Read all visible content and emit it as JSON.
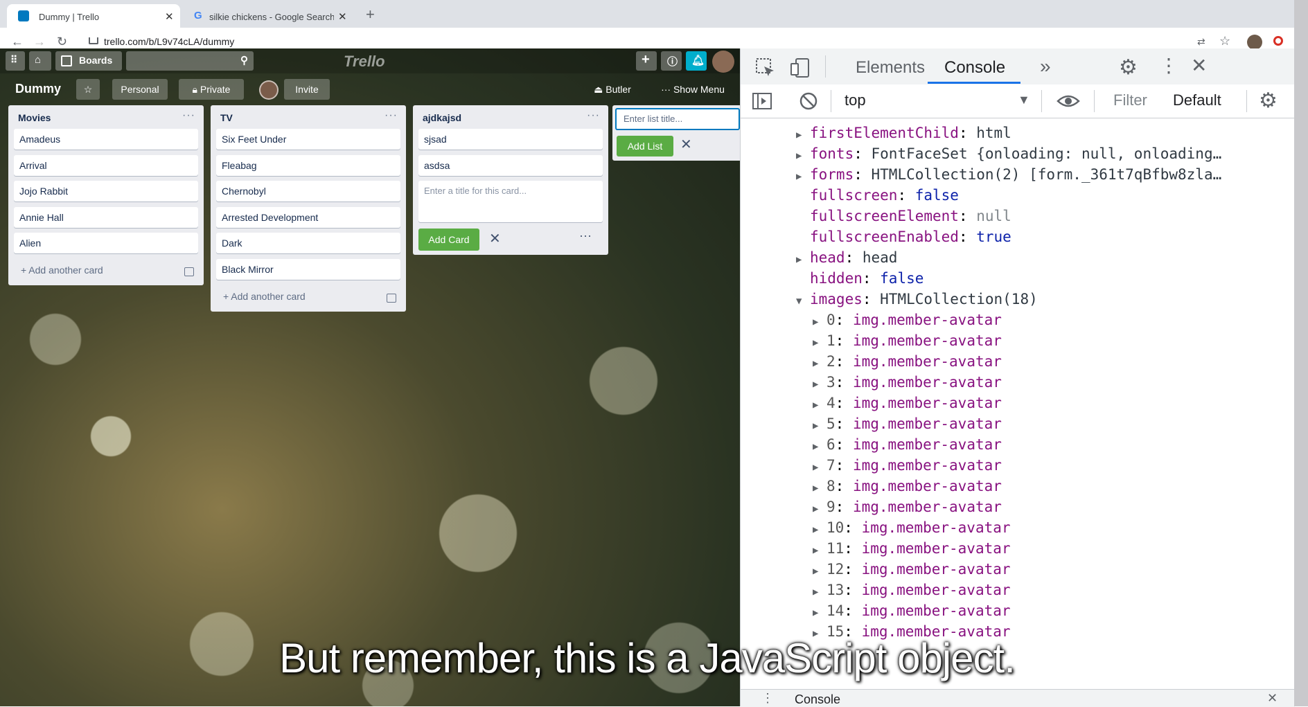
{
  "browser": {
    "tabs": [
      {
        "title": "Dummy | Trello",
        "active": true
      },
      {
        "title": "silkie chickens - Google Search",
        "active": false
      }
    ],
    "url": "trello.com/b/L9v74cLA/dummy"
  },
  "trello": {
    "top": {
      "boards_label": "Boards",
      "logo": "Trello"
    },
    "header": {
      "board_name": "Dummy",
      "personal_label": "Personal",
      "private_label": "Private",
      "invite_label": "Invite",
      "butler_label": "Butler",
      "show_menu_label": "Show Menu"
    },
    "lists": [
      {
        "title": "Movies",
        "cards": [
          "Amadeus",
          "Arrival",
          "Jojo Rabbit",
          "Annie Hall",
          "Alien"
        ],
        "add_label": "Add another card"
      },
      {
        "title": "TV",
        "cards": [
          "Six Feet Under",
          "Fleabag",
          "Chernobyl",
          "Arrested Development",
          "Dark",
          "Black Mirror"
        ],
        "add_label": "Add another card"
      },
      {
        "title": "ajdkajsd",
        "cards": [
          "sjsad",
          "asdsa"
        ],
        "composer_placeholder": "Enter a title for this card...",
        "add_card_button": "Add Card"
      }
    ],
    "new_list": {
      "placeholder": "Enter list title...",
      "button": "Add List"
    }
  },
  "devtools": {
    "tabs": {
      "elements": "Elements",
      "console": "Console",
      "more": "»"
    },
    "toolbar": {
      "context": "top",
      "filter": "Filter",
      "levels": "Default"
    },
    "console_rows": [
      {
        "key": "firstElementChild",
        "value": "html",
        "expandable": true,
        "kind": "obj"
      },
      {
        "key": "fonts",
        "value": "FontFaceSet {onloading: null, onloading…",
        "expandable": true,
        "kind": "obj"
      },
      {
        "key": "forms",
        "value": "HTMLCollection(2) [form._361t7qBfbw8zla…",
        "expandable": true,
        "kind": "obj"
      },
      {
        "key": "fullscreen",
        "value": "false",
        "expandable": false,
        "kind": "kw"
      },
      {
        "key": "fullscreenElement",
        "value": "null",
        "expandable": false,
        "kind": "null"
      },
      {
        "key": "fullscreenEnabled",
        "value": "true",
        "expandable": false,
        "kind": "kw"
      },
      {
        "key": "head",
        "value": "head",
        "expandable": true,
        "kind": "obj"
      },
      {
        "key": "hidden",
        "value": "false",
        "expandable": false,
        "kind": "kw"
      },
      {
        "key": "images",
        "value": "HTMLCollection(18)",
        "expandable": true,
        "expanded": true,
        "kind": "obj"
      }
    ],
    "image_items": [
      {
        "index": "0",
        "value": "img.member-avatar"
      },
      {
        "index": "1",
        "value": "img.member-avatar"
      },
      {
        "index": "2",
        "value": "img.member-avatar"
      },
      {
        "index": "3",
        "value": "img.member-avatar"
      },
      {
        "index": "4",
        "value": "img.member-avatar"
      },
      {
        "index": "5",
        "value": "img.member-avatar"
      },
      {
        "index": "6",
        "value": "img.member-avatar"
      },
      {
        "index": "7",
        "value": "img.member-avatar"
      },
      {
        "index": "8",
        "value": "img.member-avatar"
      },
      {
        "index": "9",
        "value": "img.member-avatar"
      },
      {
        "index": "10",
        "value": "img.member-avatar"
      },
      {
        "index": "11",
        "value": "img.member-avatar"
      },
      {
        "index": "12",
        "value": "img.member-avatar"
      },
      {
        "index": "13",
        "value": "img.member-avatar"
      },
      {
        "index": "14",
        "value": "img.member-avatar"
      },
      {
        "index": "15",
        "value": "img.member-avatar"
      }
    ],
    "drawer_label": "Console"
  },
  "caption": "But remember, this is a JavaScript object.",
  "colors": {
    "trello_green": "#5aac44",
    "devtools_accent": "#1a73e8",
    "console_key": "#881280",
    "console_keyword": "#0d22aa"
  }
}
